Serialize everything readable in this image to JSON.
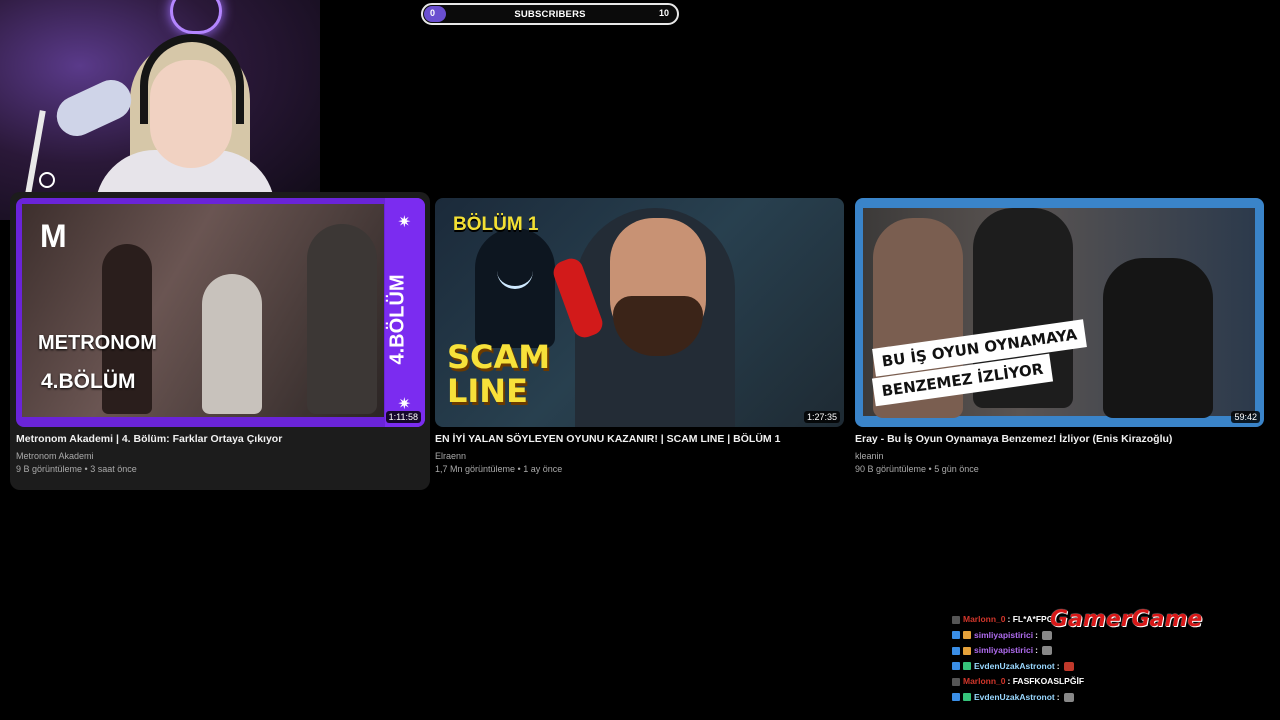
{
  "subscribers": {
    "current": "0",
    "label": "SUBSCRIBERS",
    "goal": "10",
    "progress": 0
  },
  "videos": [
    {
      "title": "Metronom Akademi | 4. Bölüm: Farklar Ortaya Çıkıyor",
      "channel": "Metronom Akademi",
      "stats": "9 B görüntüleme • 3 saat önce",
      "duration": "1:11:58",
      "thumb": {
        "logo": "M",
        "title": "METRONOM",
        "episode": "4.BÖLÜM",
        "vertical": "4.BÖLÜM"
      }
    },
    {
      "title": "EN İYİ YALAN SÖYLEYEN OYUNU KAZANIR! | SCAM LINE | BÖLÜM 1",
      "channel": "Elraenn",
      "stats": "1,7 Mn görüntüleme • 1 ay önce",
      "duration": "1:27:35",
      "thumb": {
        "episode": "BÖLÜM 1",
        "scam": "SCAM",
        "line": "LINE"
      }
    },
    {
      "title": "Eray - Bu İş Oyun Oynamaya Benzemez! İzliyor (Enis Kirazoğlu)",
      "channel": "kleanin",
      "stats": "90 B görüntüleme • 5 gün önce",
      "duration": "59:42",
      "thumb": {
        "line1": "BU İŞ OYUN OYNAMAYA",
        "line2": "BENZEMEZ İZLİYOR"
      }
    }
  ],
  "chat": [
    {
      "user": "Marlonn_0",
      "color": "#d2362b",
      "message": ": FL*A*FPG"
    },
    {
      "user": "simliyapistirici",
      "color": "#b06cf0",
      "message": ":"
    },
    {
      "user": "simliyapistirici",
      "color": "#b06cf0",
      "message": ":"
    },
    {
      "user": "EvdenUzakAstronot",
      "color": "#9ad8ff",
      "message": ":"
    },
    {
      "user": "Marlonn_0",
      "color": "#d2362b",
      "message": ": FASFKOASLPĞİF"
    },
    {
      "user": "EvdenUzakAstronot",
      "color": "#9ad8ff",
      "message": ":"
    }
  ],
  "logo_text": "GamerGame",
  "colors": {
    "accent": "#7b2cf0",
    "background": "#000000",
    "hover_card": "#1c1c1c"
  }
}
